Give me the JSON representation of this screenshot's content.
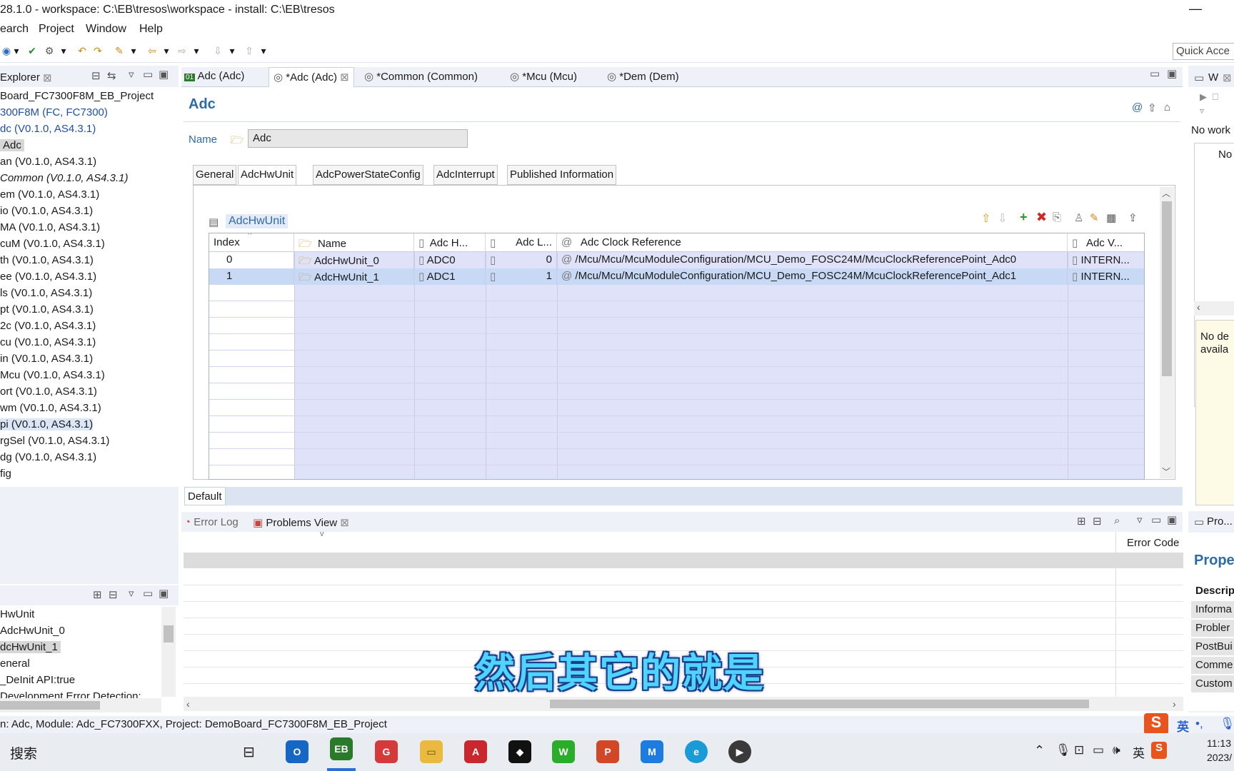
{
  "window": {
    "title": "28.1.0 - workspace: C:\\EB\\tresos\\workspace - install: C:\\EB\\tresos",
    "minimize": "—"
  },
  "menu": [
    "earch",
    "Project",
    "Window",
    "Help"
  ],
  "quick_access": "Quick Acce",
  "explorer": {
    "title": "Explorer",
    "items": [
      "Board_FC7300F8M_EB_Project",
      "300F8M (FC, FC7300)",
      "dc (V0.1.0, AS4.3.1)",
      "Adc",
      "an (V0.1.0, AS4.3.1)",
      "Common (V0.1.0, AS4.3.1)",
      "em (V0.1.0, AS4.3.1)",
      "io (V0.1.0, AS4.3.1)",
      "MA (V0.1.0, AS4.3.1)",
      "cuM (V0.1.0, AS4.3.1)",
      "th (V0.1.0, AS4.3.1)",
      "ee (V0.1.0, AS4.3.1)",
      "ls (V0.1.0, AS4.3.1)",
      "pt (V0.1.0, AS4.3.1)",
      "2c (V0.1.0, AS4.3.1)",
      "cu (V0.1.0, AS4.3.1)",
      "in (V0.1.0, AS4.3.1)",
      "Mcu (V0.1.0, AS4.3.1)",
      "ort (V0.1.0, AS4.3.1)",
      "wm (V0.1.0, AS4.3.1)",
      "pi (V0.1.0, AS4.3.1)",
      "rgSel (V0.1.0, AS4.3.1)",
      "dg (V0.1.0, AS4.3.1)",
      "fig"
    ]
  },
  "outline": {
    "items": [
      "HwUnit",
      "AdcHwUnit_0",
      "dcHwUnit_1",
      "eneral",
      "_DeInit API:true",
      "Development Error Detection:"
    ]
  },
  "editor_tabs": [
    "Adc (Adc)",
    "*Adc (Adc)",
    "*Common (Common)",
    "*Mcu (Mcu)",
    "*Dem (Dem)"
  ],
  "editor": {
    "heading": "Adc",
    "name_label": "Name",
    "name_value": "Adc",
    "config_tabs": [
      "General",
      "AdcHwUnit",
      "AdcPowerStateConfig",
      "AdcInterrupt",
      "Published Information"
    ],
    "section": "AdcHwUnit",
    "columns": [
      "Index",
      "Name",
      "Adc H...",
      "Adc L...",
      "Adc Clock Reference",
      "Adc V..."
    ],
    "rows": [
      {
        "index": "0",
        "name": "AdcHwUnit_0",
        "hw": "ADC0",
        "l": "0",
        "clock": "/Mcu/Mcu/McuModuleConfiguration/MCU_Demo_FOSC24M/McuClockReferencePoint_Adc0",
        "v": "INTERN..."
      },
      {
        "index": "1",
        "name": "AdcHwUnit_1",
        "hw": "ADC1",
        "l": "1",
        "clock": "/Mcu/Mcu/McuModuleConfiguration/MCU_Demo_FOSC24M/McuClockReferencePoint_Adc1",
        "v": "INTERN..."
      }
    ],
    "default_tab": "Default"
  },
  "bottom": {
    "tabs": [
      "Error Log",
      "Problems View"
    ],
    "error_code_header": "Error Code"
  },
  "right_panel": {
    "title": "W",
    "no_work": "No work",
    "no": "No",
    "no_desc": [
      "No de",
      "availa"
    ],
    "props_tab": "Pro...",
    "props_heading": "Proper",
    "props_items": [
      "Descrip",
      "Informa",
      "Probler",
      "PostBui",
      "Comme",
      "Custom"
    ]
  },
  "status_text": "n: Adc, Module: Adc_FC7300FXX, Project: DemoBoard_FC7300F8M_EB_Project",
  "taskbar": {
    "search": "搜索",
    "ime": "英",
    "time": "11:13",
    "date": "2023/"
  },
  "subtitle": "然后其它的就是"
}
